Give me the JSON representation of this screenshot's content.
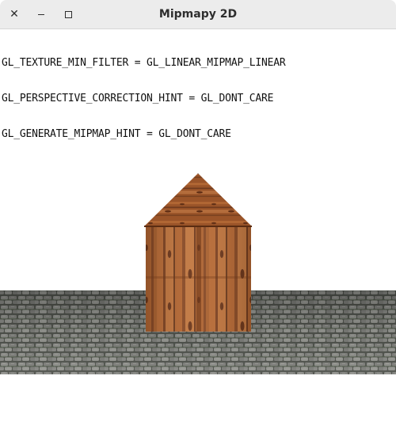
{
  "window": {
    "title": "Mipmapy 2D",
    "buttons": {
      "close_icon": "close-icon",
      "minimize_icon": "minimize-icon",
      "maximize_icon": "maximize-icon"
    }
  },
  "overlay": {
    "lines": [
      "GL_TEXTURE_MIN_FILTER = GL_LINEAR_MIPMAP_LINEAR",
      "GL_PERSPECTIVE_CORRECTION_HINT = GL_DONT_CARE",
      "GL_GENERATE_MIPMAP_HINT = GL_DONT_CARE"
    ]
  },
  "scene": {
    "background_color": "#ffffff",
    "floor_color": "#6f6f6c",
    "house_wood_color": "#b0602a",
    "roof_color": "#a55a2c"
  }
}
